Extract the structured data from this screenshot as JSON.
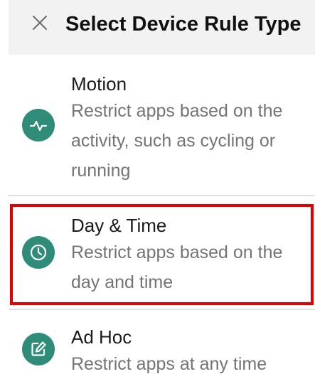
{
  "header": {
    "title": "Select Device Rule Type",
    "close_icon": "close-icon"
  },
  "options": [
    {
      "icon": "activity-pulse-icon",
      "title": "Motion",
      "description": "Restrict apps based on the activity, such as cycling or running"
    },
    {
      "icon": "clock-icon",
      "title": "Day & Time",
      "description": "Restrict apps based on the day and time",
      "highlighted": true
    },
    {
      "icon": "edit-icon",
      "title": "Ad Hoc",
      "description": "Restrict apps at any time"
    }
  ],
  "colors": {
    "accent": "#2e8c78",
    "highlight_border": "#e30000",
    "header_bg": "#f2f2f2"
  }
}
